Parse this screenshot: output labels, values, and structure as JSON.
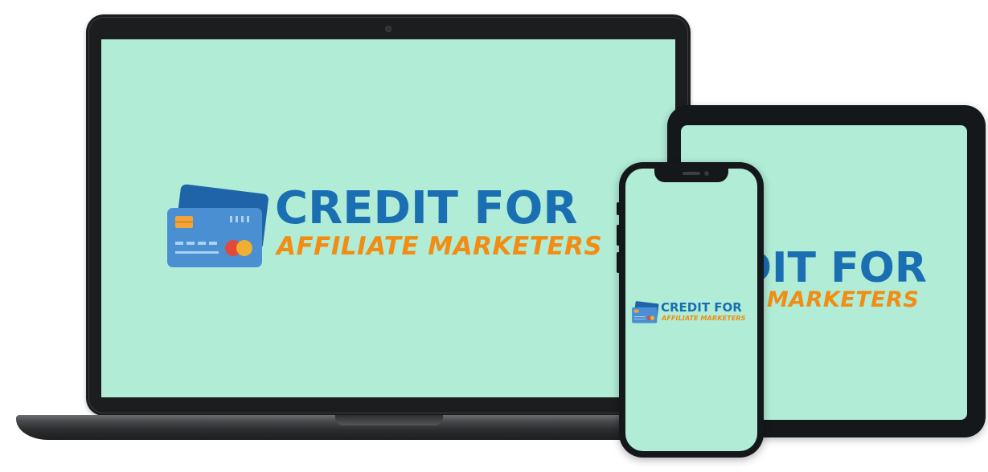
{
  "logo": {
    "line1": "CREDIT FOR",
    "line2": "AFFILIATE MARKETERS"
  },
  "tablet_logo": {
    "line1": "DIT FOR",
    "line2": "E MARKETERS"
  },
  "colors": {
    "screen_background": "#b0ecd6",
    "logo_blue": "#1a6fb3",
    "logo_orange": "#f28c12",
    "card_front": "#4a8fd1",
    "card_back": "#1f63a8",
    "device_frame": "#1b1d1f"
  }
}
